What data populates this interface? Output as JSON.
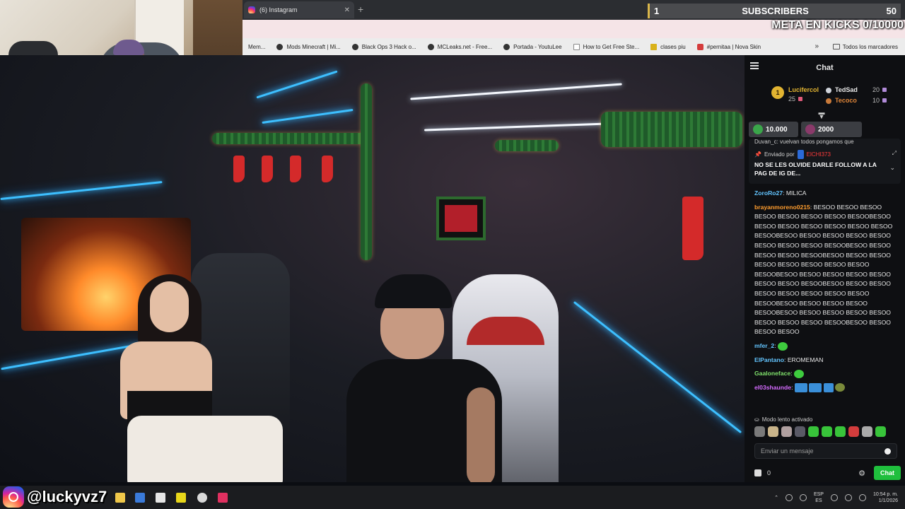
{
  "browser": {
    "active_tab_title": "(6) Instagram",
    "bookmarks": [
      {
        "label": "Mem...",
        "icon": "none"
      },
      {
        "label": "Mods Minecraft | Mi...",
        "icon": "dark-circle"
      },
      {
        "label": "Black Ops 3 Hack o...",
        "icon": "dark-circle"
      },
      {
        "label": "MCLeaks.net - Free...",
        "icon": "dark-circle"
      },
      {
        "label": "Portada - YoutuLee",
        "icon": "dark-circle"
      },
      {
        "label": "How to Get Free Ste...",
        "icon": "blank-page"
      },
      {
        "label": "clases piu",
        "icon": "yellow-square"
      },
      {
        "label": "#pernitaa | Nova Skin",
        "icon": "red-square"
      }
    ],
    "bookmarks_overflow": "»",
    "all_bookmarks_label": "Todos los marcadores"
  },
  "overlay": {
    "subscribers_count": "1",
    "subscribers_label": "SUBSCRIBERS",
    "subscribers_goal": "50",
    "kicks_goal": "META EN KICKS 0/10000",
    "instagram_handle": "@luckyvz7"
  },
  "chat": {
    "title": "Chat",
    "leaderboard": {
      "first": {
        "rank": "1",
        "name": "Lucifercol",
        "points": "25"
      },
      "second": {
        "name": "TedSad",
        "points": "20"
      },
      "third": {
        "name": "Tecoco",
        "points": "10"
      }
    },
    "gifts": [
      {
        "amount": "10.000"
      },
      {
        "amount": "2000"
      }
    ],
    "pinned": {
      "cut_off_text": "Duvan_c: vuelvan todos pongamos que",
      "sent_by_label": "Enviado por",
      "sender": "ElCHI373",
      "message": "NO SE LES OLVIDE DARLE FOLLOW A LA PAG DE IG DE..."
    },
    "messages": [
      {
        "user": "ZoroRo27",
        "color": "#63c5ff",
        "text": "MILICA"
      },
      {
        "user": "brayanmoreno0215",
        "color": "#ff9d2e",
        "text": "BESOO BESOO BESOO BESOO BESOO BESOO BESOO BESOOBESOO BESOO BESOO BESOO BESOO BESOO BESOO BESOOBESOO BESOO BESOO BESOO BESOO BESOO BESOO BESOO BESOOBESOO BESOO BESOO BESOO BESOOBESOO BESOO BESOO BESOO BESOO BESOO BESOO BESOO BESOOBESOO BESOO BESOO BESOO BESOO BESOO BESOO BESOOBESOO BESOO BESOO BESOO BESOO BESOO BESOO BESOO BESOOBESOO BESOO BESOO BESOO BESOOBESOO BESOO BESOO BESOO BESOO BESOO BESOO BESOO BESOOBESOO BESOO BESOO BESOO"
      },
      {
        "user": "mfer_2",
        "color": "#63c5ff",
        "text": ""
      },
      {
        "user": "ElPantano",
        "color": "#63c5ff",
        "text": "EROMEMAN"
      },
      {
        "user": "Gaaloneface",
        "color": "#7fe06b",
        "text": ""
      },
      {
        "user": "el03shaunde",
        "color": "#d56bff",
        "text": ""
      }
    ],
    "slow_mode": "Modo lento activado",
    "input_placeholder": "Enviar un mensaje",
    "currency_value": "0",
    "send_label": "Chat"
  },
  "taskbar": {
    "lang_top": "ESP",
    "lang_bottom": "ES",
    "time": "10:54 p. m.",
    "date": "1/1/2026"
  }
}
